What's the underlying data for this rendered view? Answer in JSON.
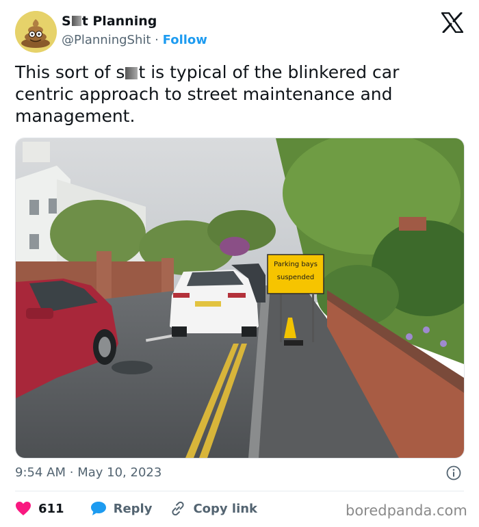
{
  "header": {
    "name_prefix": "S",
    "name_suffix": "t Planning",
    "handle": "@PlanningShit",
    "separator": "·",
    "follow_label": "Follow"
  },
  "tweet": {
    "text_part1": "This sort of s",
    "text_part2": "t is typical of the blinkered car centric approach to street maintenance and management."
  },
  "photo": {
    "sign_line1": "Parking bays",
    "sign_line2": "suspended"
  },
  "meta": {
    "time": "9:54 AM",
    "separator": "·",
    "date": "May 10, 2023"
  },
  "actions": {
    "like_count": "611",
    "reply_label": "Reply",
    "copy_link_label": "Copy link"
  },
  "watermark": "boredpanda.com",
  "colors": {
    "accent": "#1d9bf0",
    "like": "#f91880",
    "reply": "#1d9bf0",
    "muted": "#536471",
    "sign": "#f6c400"
  },
  "icons": [
    "avatar-poop-icon",
    "x-logo-icon",
    "info-icon",
    "heart-icon",
    "reply-bubble-icon",
    "link-icon"
  ]
}
